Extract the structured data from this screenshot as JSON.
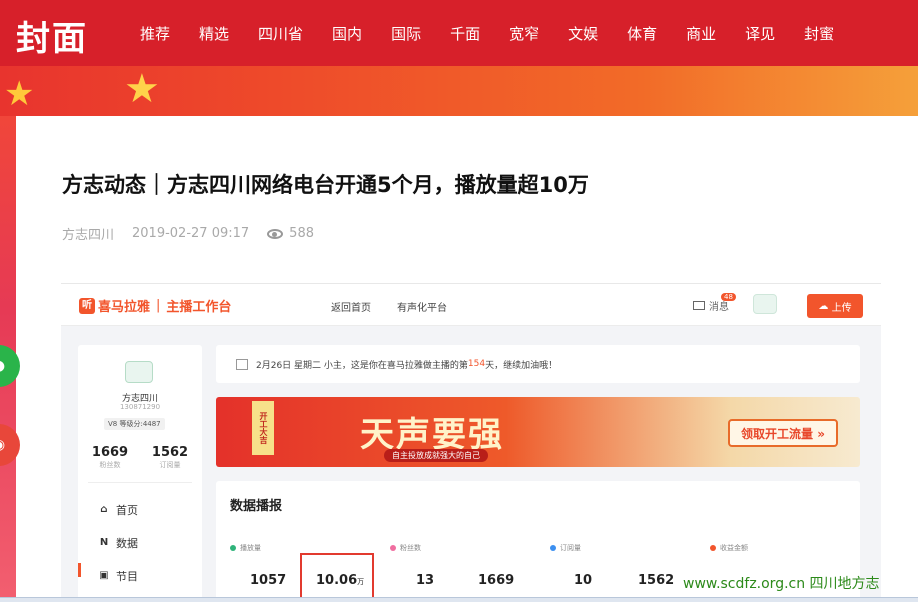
{
  "site": {
    "logo": "封面",
    "nav": [
      "推荐",
      "精选",
      "四川省",
      "国内",
      "国际",
      "千面",
      "宽窄",
      "文娱",
      "体育",
      "商业",
      "译见",
      "封蜜"
    ]
  },
  "article": {
    "title": "方志动态｜方志四川网络电台开通5个月，播放量超10万",
    "author": "方志四川",
    "date": "2019-02-27 09:17",
    "views": "588",
    "views_icon": "eye-icon"
  },
  "embedded": {
    "brand_name": "喜马拉雅",
    "brand_sep": "|",
    "workspace": "主播工作台",
    "nav": [
      "返回首页",
      "有声化平台"
    ],
    "message_label": "消息",
    "message_count": "48",
    "upload_label": "上传",
    "profile": {
      "name": "方志四川",
      "id": "130871290",
      "level": "V8  等级分:4487",
      "fans": "1669",
      "fans_label": "粉丝数",
      "subs": "1562",
      "subs_label": "订阅量"
    },
    "menu": [
      "首页",
      "数据",
      "节目"
    ],
    "notice": {
      "prefix": "2月26日 星期二  小主，这是你在喜马拉雅做主播的第 ",
      "days": "154",
      "suffix": " 天，继续加油哦！"
    },
    "ad": {
      "tag": "开工大吉",
      "headline": "天声要强",
      "sub": "自主投放成就强大的自己",
      "cta": "领取开工流量 »"
    },
    "panel": {
      "title": "数据播报",
      "columns": [
        {
          "label": "播放量",
          "color": "#2fb37a",
          "a": "1057",
          "b": "10.06",
          "b_unit": "万"
        },
        {
          "label": "粉丝数",
          "color": "#f06ea0",
          "a": "13",
          "b": "1669",
          "b_unit": ""
        },
        {
          "label": "订阅量",
          "color": "#3c8ff0",
          "a": "10",
          "b": "1562",
          "b_unit": ""
        },
        {
          "label": "收益金额",
          "color": "#f2552c",
          "a": "",
          "b": "",
          "b_unit": ""
        }
      ]
    }
  },
  "watermark": "www.scdfz.org.cn  四川地方志",
  "colors": {
    "brand_red": "#d7202a",
    "accent_orange": "#f2552c",
    "watermark_green": "#2c8a1a"
  }
}
